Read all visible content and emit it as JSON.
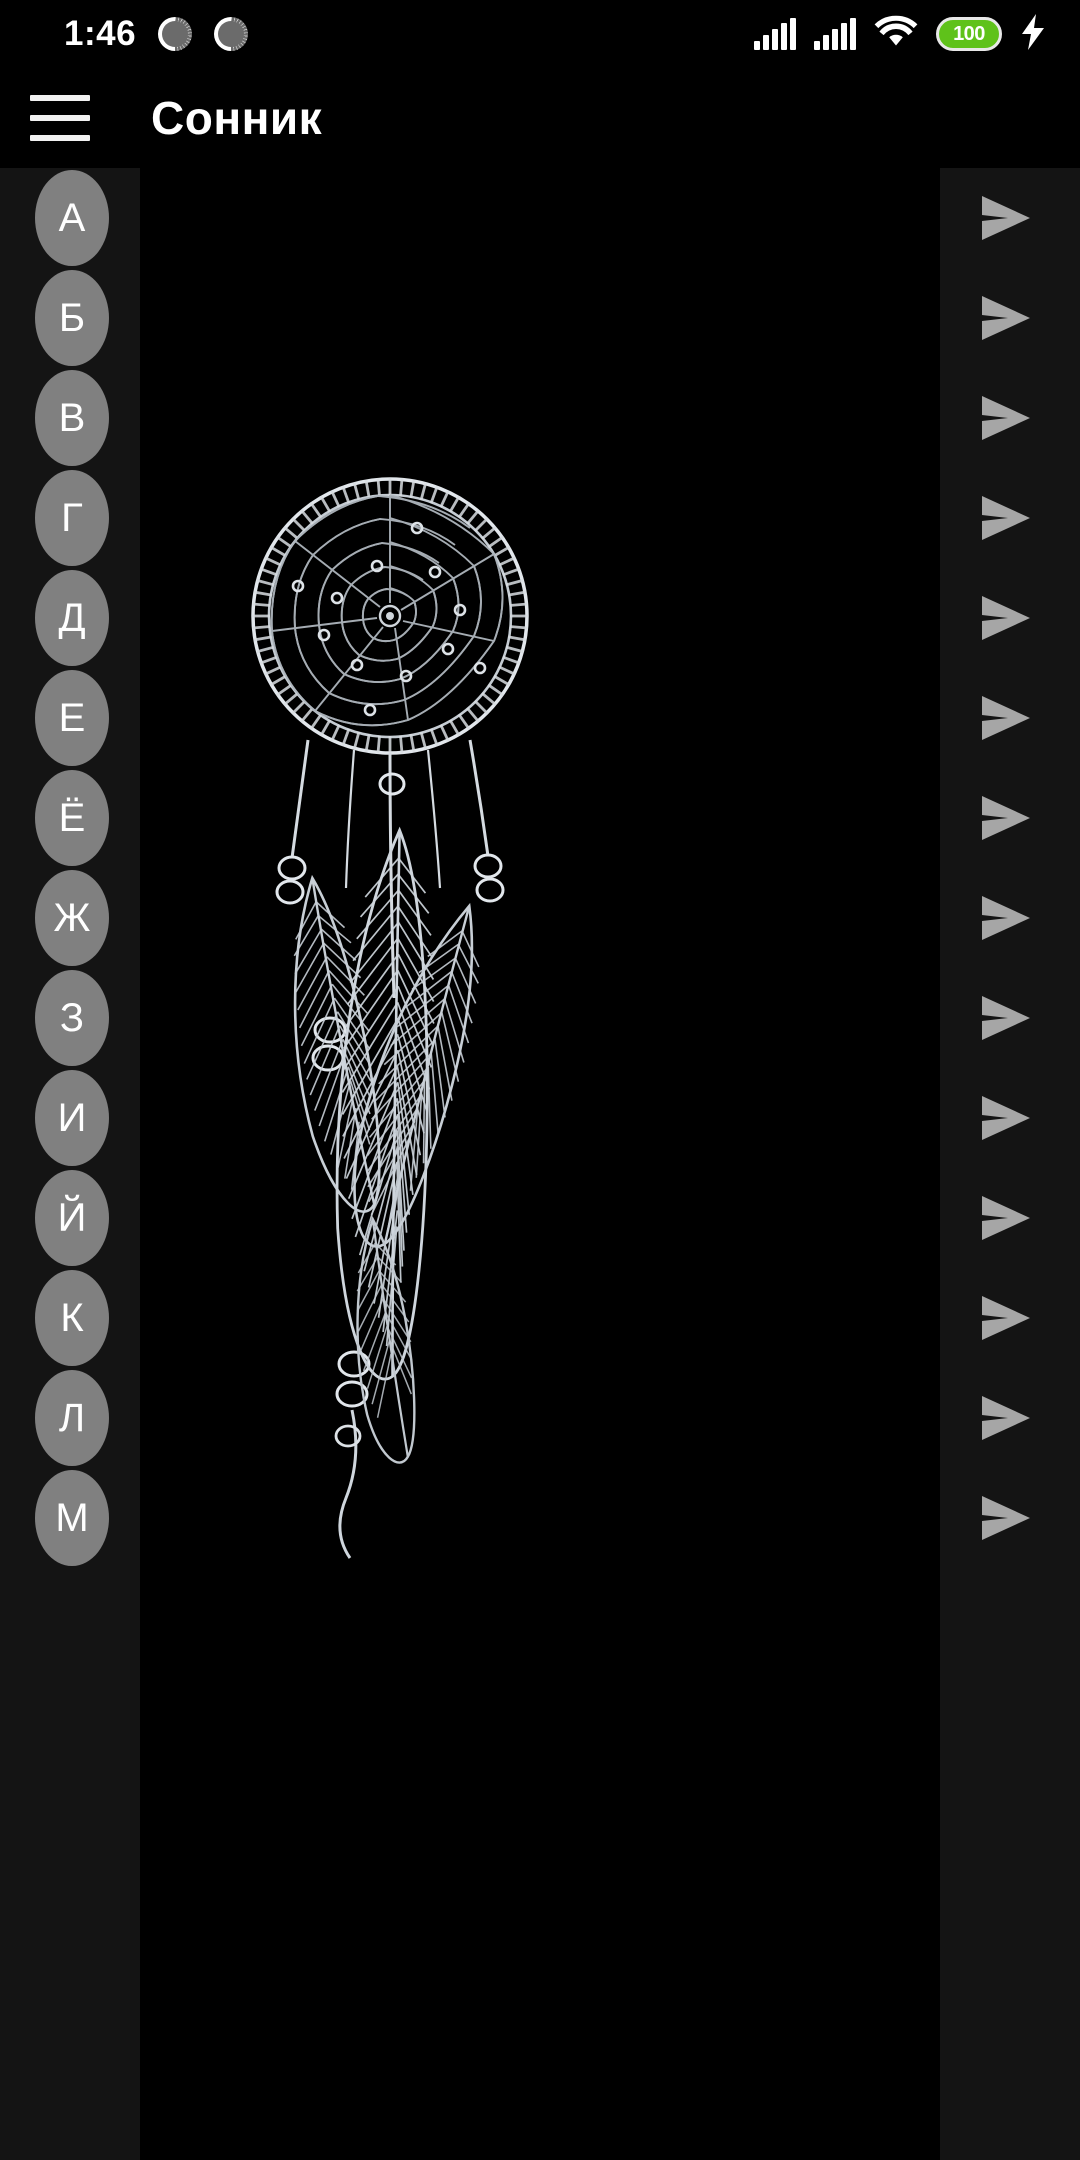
{
  "status_bar": {
    "clock": "1:46",
    "icons": [
      "spinner-icon",
      "spinner-icon",
      "signal-bars-icon",
      "signal-bars-icon",
      "wifi-icon",
      "battery-icon",
      "charging-bolt-icon"
    ],
    "battery_level": "100",
    "battery_color": "#5fc21a"
  },
  "app_bar": {
    "menu_icon": "hamburger-menu-icon",
    "title": "Сонник",
    "background": "#000000",
    "text_color": "#ffffff"
  },
  "theme": {
    "content_background": "#141414",
    "art_background": "#000000",
    "circle_fill": "#808080",
    "circle_text": "#ffffff",
    "arrow_fill": "#a6a6a6"
  },
  "alphabet_list": {
    "arrow_icon": "send-arrow-icon",
    "items": [
      {
        "letter": "А"
      },
      {
        "letter": "Б"
      },
      {
        "letter": "В"
      },
      {
        "letter": "Г"
      },
      {
        "letter": "Д"
      },
      {
        "letter": "Е"
      },
      {
        "letter": "Ё"
      },
      {
        "letter": "Ж"
      },
      {
        "letter": "З"
      },
      {
        "letter": "И"
      },
      {
        "letter": "Й"
      },
      {
        "letter": "К"
      },
      {
        "letter": "Л"
      },
      {
        "letter": "М"
      }
    ]
  },
  "artwork": {
    "name": "dreamcatcher-illustration",
    "description": "Белый контурный рисунок ловца снов с перьями на чёрном фоне"
  }
}
